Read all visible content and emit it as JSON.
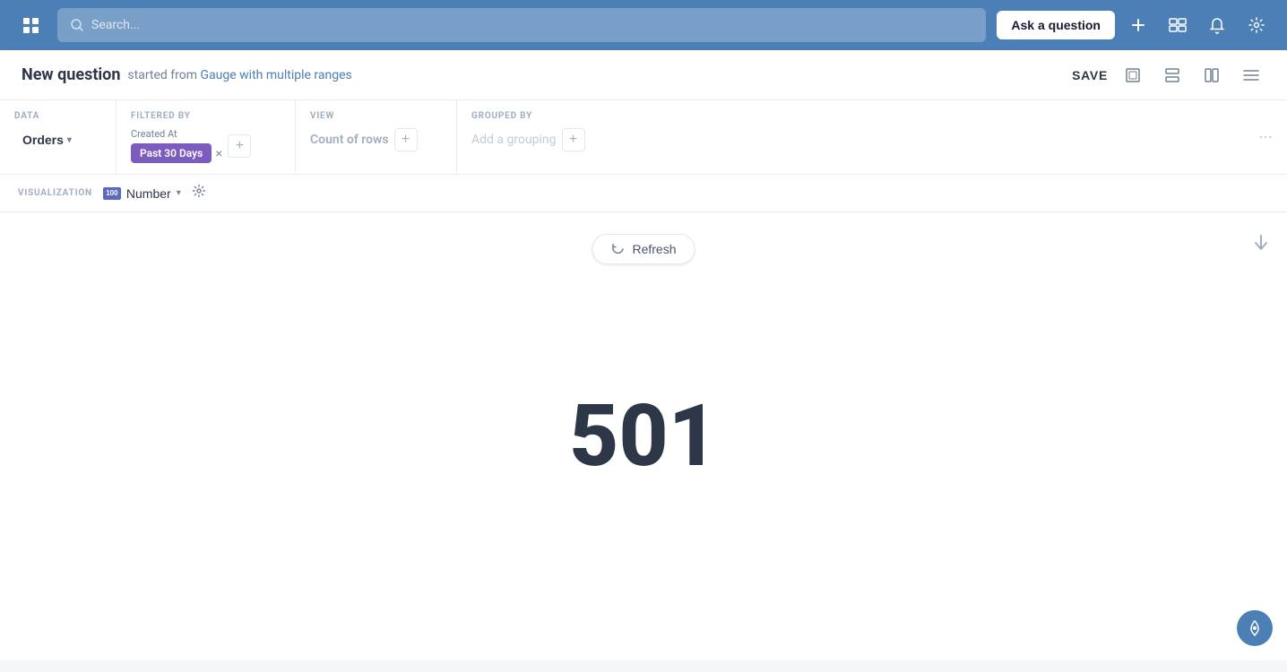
{
  "topnav": {
    "search_placeholder": "Search...",
    "ask_question_label": "Ask a question"
  },
  "header": {
    "title": "New question",
    "subtitle_prefix": "started from",
    "subtitle_link": "Gauge with multiple ranges",
    "save_label": "SAVE"
  },
  "query_builder": {
    "data_label": "DATA",
    "filtered_by_label": "FILTERED BY",
    "view_label": "VIEW",
    "grouped_by_label": "GROUPED BY",
    "data_source": "Orders",
    "filter_field": "Created At",
    "filter_pill": "Past 30 Days",
    "view_metric": "Count of rows",
    "add_grouping_placeholder": "Add a grouping"
  },
  "visualization": {
    "section_label": "VISUALIZATION",
    "type_label": "Number",
    "type_icon": "100"
  },
  "main": {
    "refresh_label": "Refresh",
    "result_value": "501"
  }
}
